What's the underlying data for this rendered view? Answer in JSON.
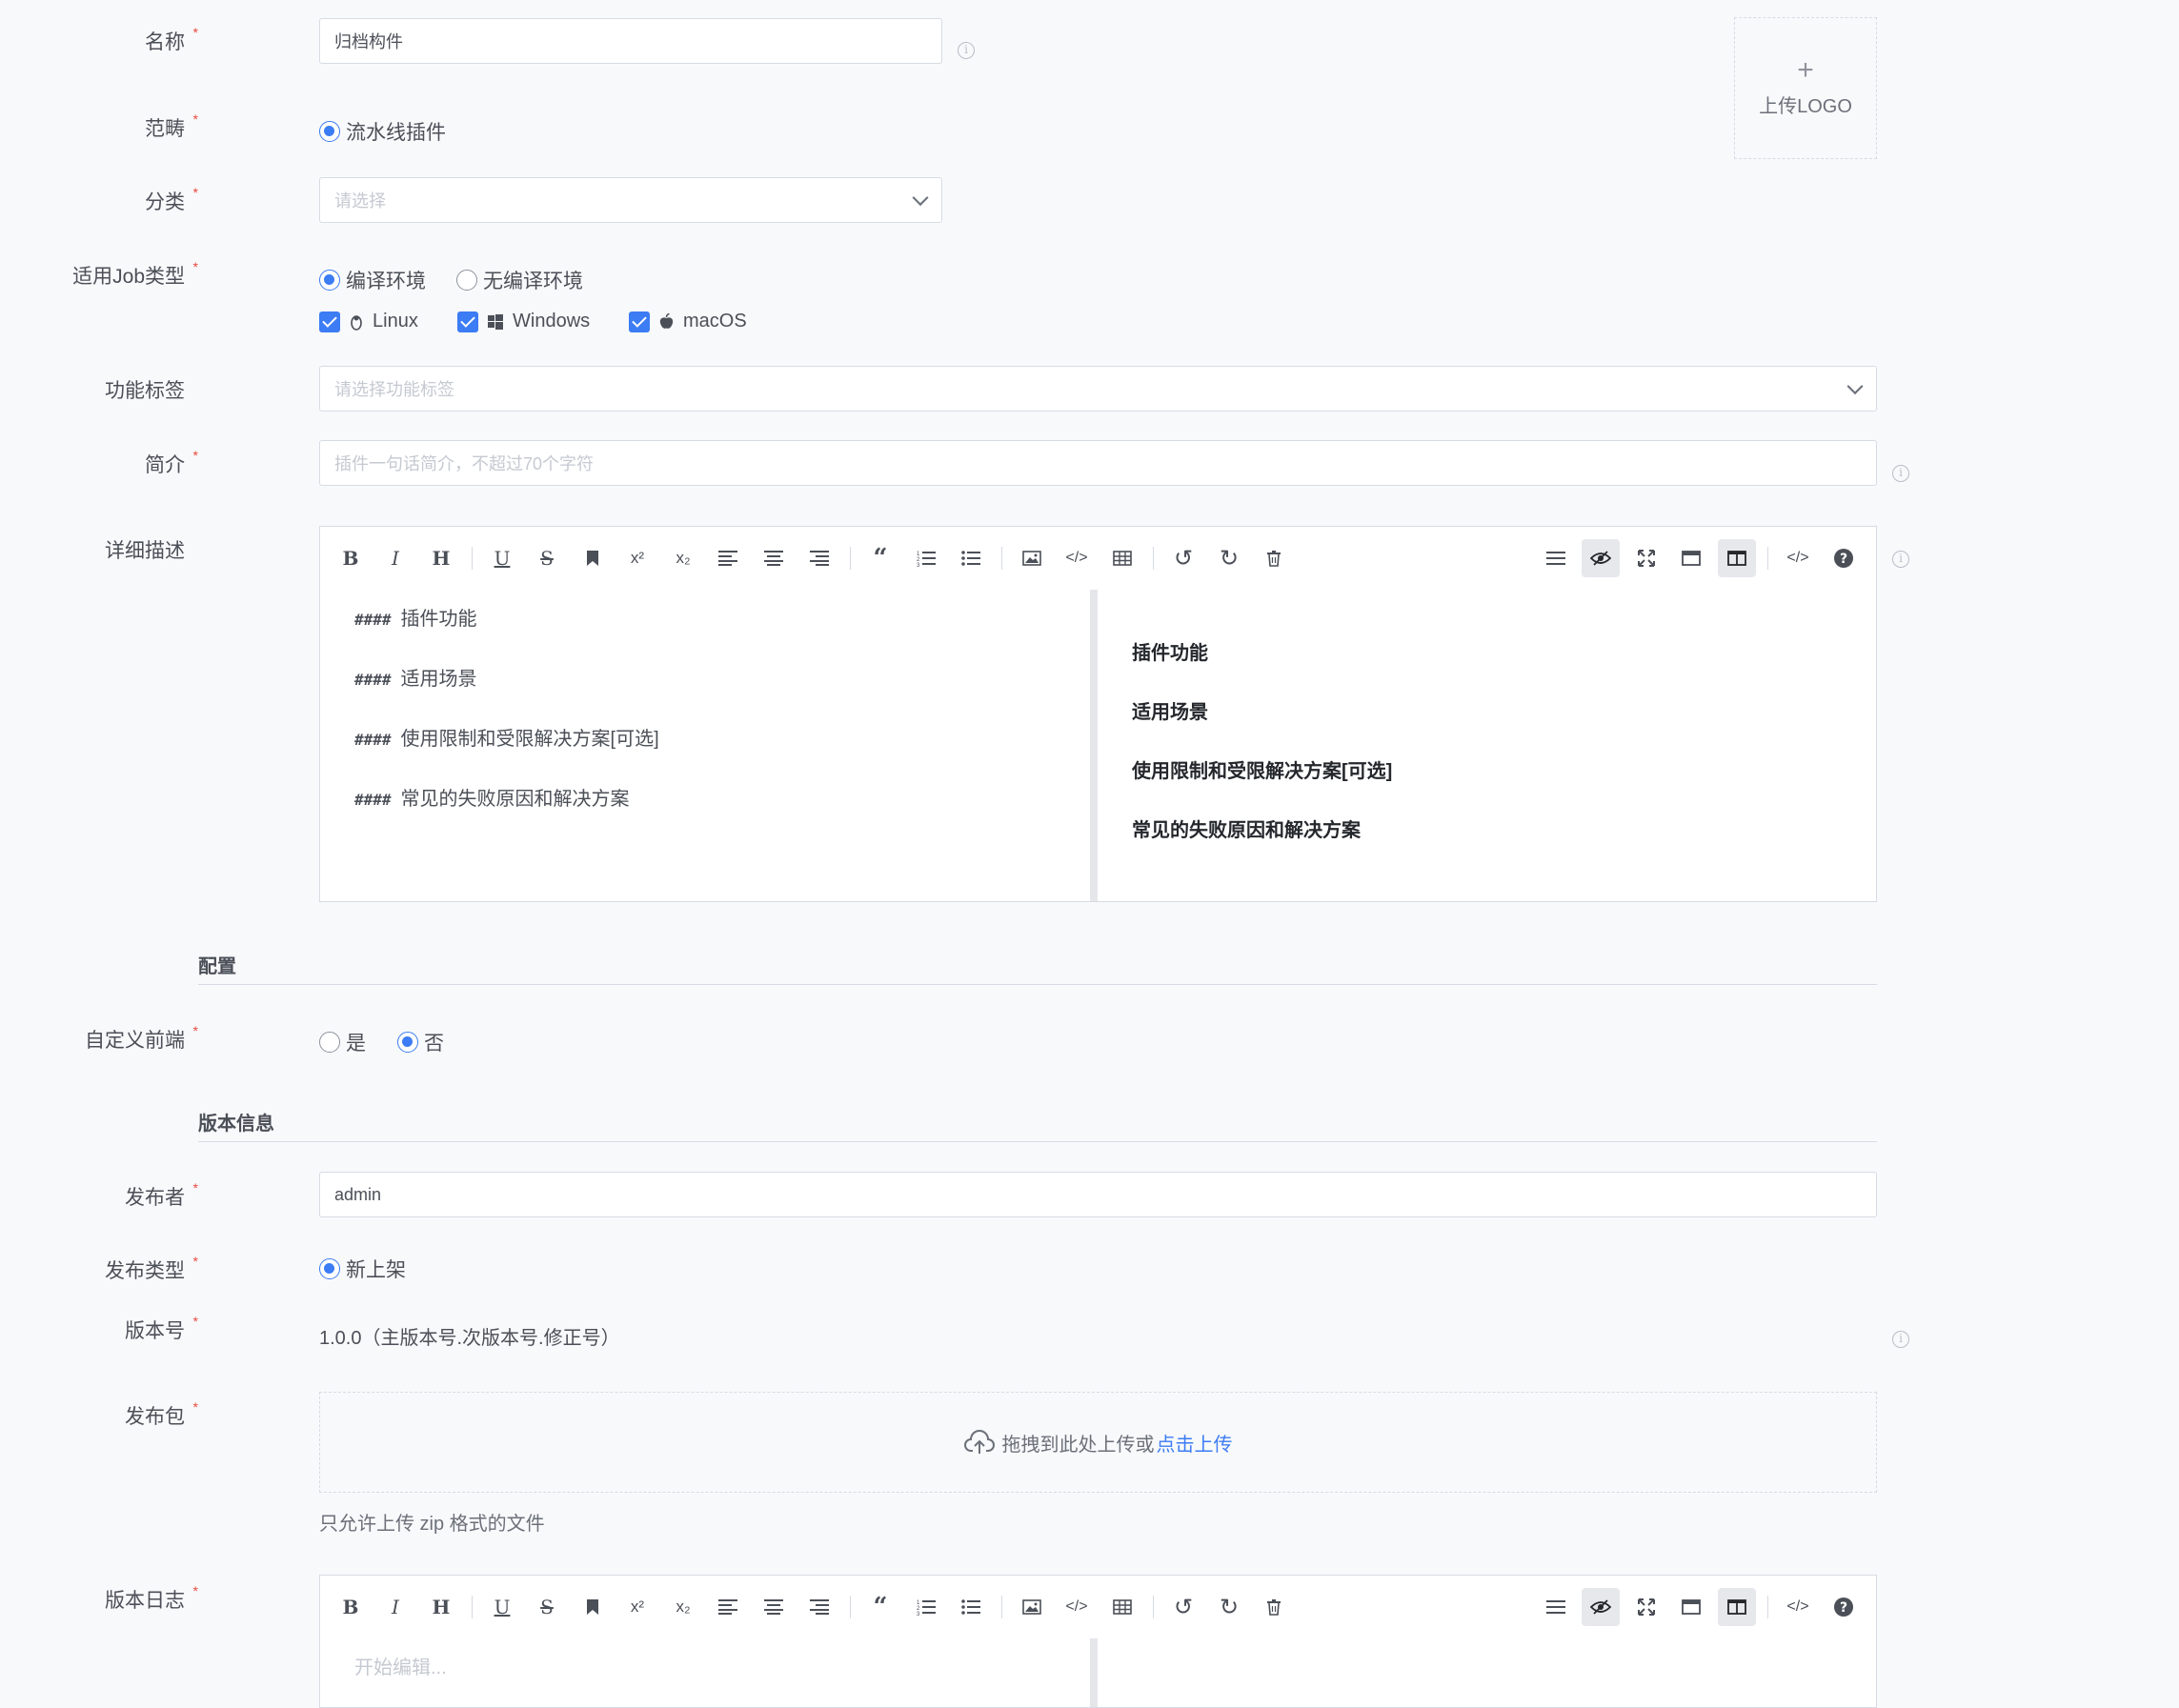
{
  "form": {
    "name": {
      "label": "名称",
      "value": "归档构件"
    },
    "scope": {
      "label": "范畴",
      "option": "流水线插件"
    },
    "category": {
      "label": "分类",
      "placeholder": "请选择"
    },
    "job_type": {
      "label": "适用Job类型",
      "options": [
        "编译环境",
        "无编译环境"
      ],
      "os": [
        "Linux",
        "Windows",
        "macOS"
      ]
    },
    "tags": {
      "label": "功能标签",
      "placeholder": "请选择功能标签"
    },
    "summary": {
      "label": "简介",
      "placeholder": "插件一句话简介，不超过70个字符"
    },
    "description": {
      "label": "详细描述",
      "markdown_lines": [
        "插件功能",
        "适用场景",
        "使用限制和受限解决方案[可选]",
        "常见的失败原因和解决方案"
      ],
      "heading_prefix": "####",
      "preview_lines": [
        "插件功能",
        "适用场景",
        "使用限制和受限解决方案[可选]",
        "常见的失败原因和解决方案"
      ]
    },
    "logo": {
      "label": "上传LOGO",
      "plus": "+"
    }
  },
  "config": {
    "title": "配置",
    "custom_frontend": {
      "label": "自定义前端",
      "options": [
        "是",
        "否"
      ]
    }
  },
  "version": {
    "title": "版本信息",
    "publisher": {
      "label": "发布者",
      "value": "admin"
    },
    "release_type": {
      "label": "发布类型",
      "option": "新上架"
    },
    "version_no": {
      "label": "版本号",
      "value": "1.0.0（主版本号.次版本号.修正号）"
    },
    "package": {
      "label": "发布包",
      "drop_text": "拖拽到此处上传或",
      "click_text": "点击上传",
      "hint": "只允许上传 zip 格式的文件"
    },
    "changelog": {
      "label": "版本日志",
      "placeholder": "开始编辑..."
    }
  },
  "required_mark": "*",
  "info_glyph": "i",
  "toolbar_icons": [
    "bold-icon",
    "italic-icon",
    "heading-icon",
    "underline-icon",
    "strikethrough-icon",
    "bookmark-icon",
    "superscript-icon",
    "subscript-icon",
    "align-left-icon",
    "align-center-icon",
    "align-right-icon",
    "quote-icon",
    "ordered-list-icon",
    "unordered-list-icon",
    "image-icon",
    "code-icon",
    "table-icon",
    "undo-icon",
    "redo-icon",
    "trash-icon",
    "navigation-icon",
    "preview-icon",
    "fullscreen-icon",
    "window-icon",
    "split-icon",
    "html-icon",
    "help-icon"
  ],
  "colors": {
    "accent": "#3c7cf4",
    "required": "#e8493f",
    "border": "#d7dbe3",
    "background": "#f8f9fb"
  }
}
